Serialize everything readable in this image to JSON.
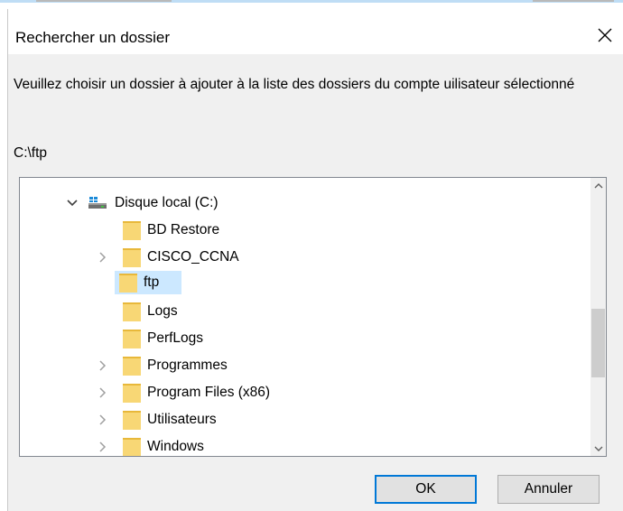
{
  "dialog": {
    "title": "Rechercher un dossier",
    "instruction": "Veuillez choisir un dossier à ajouter à la liste des dossiers du compte uilisateur sélectionné",
    "selected_path": "C:\\ftp"
  },
  "tree": {
    "drive": {
      "label": "Disque local (C:)",
      "icon": "drive-icon",
      "expanded": true
    },
    "folders": [
      {
        "label": "BD Restore",
        "has_children": false,
        "selected": false
      },
      {
        "label": "CISCO_CCNA",
        "has_children": true,
        "selected": false
      },
      {
        "label": "ftp",
        "has_children": false,
        "selected": true
      },
      {
        "label": "Logs",
        "has_children": false,
        "selected": false
      },
      {
        "label": "PerfLogs",
        "has_children": false,
        "selected": false
      },
      {
        "label": "Programmes",
        "has_children": true,
        "selected": false
      },
      {
        "label": "Program Files (x86)",
        "has_children": true,
        "selected": false
      },
      {
        "label": "Utilisateurs",
        "has_children": true,
        "selected": false
      },
      {
        "label": "Windows",
        "has_children": true,
        "selected": false
      }
    ]
  },
  "buttons": {
    "ok_label": "OK",
    "cancel_label": "Annuler"
  },
  "colors": {
    "selection": "#cce8ff",
    "folder": "#f8d775",
    "default_button_border": "#0078d7",
    "dialog_background": "#f0f0f0"
  }
}
